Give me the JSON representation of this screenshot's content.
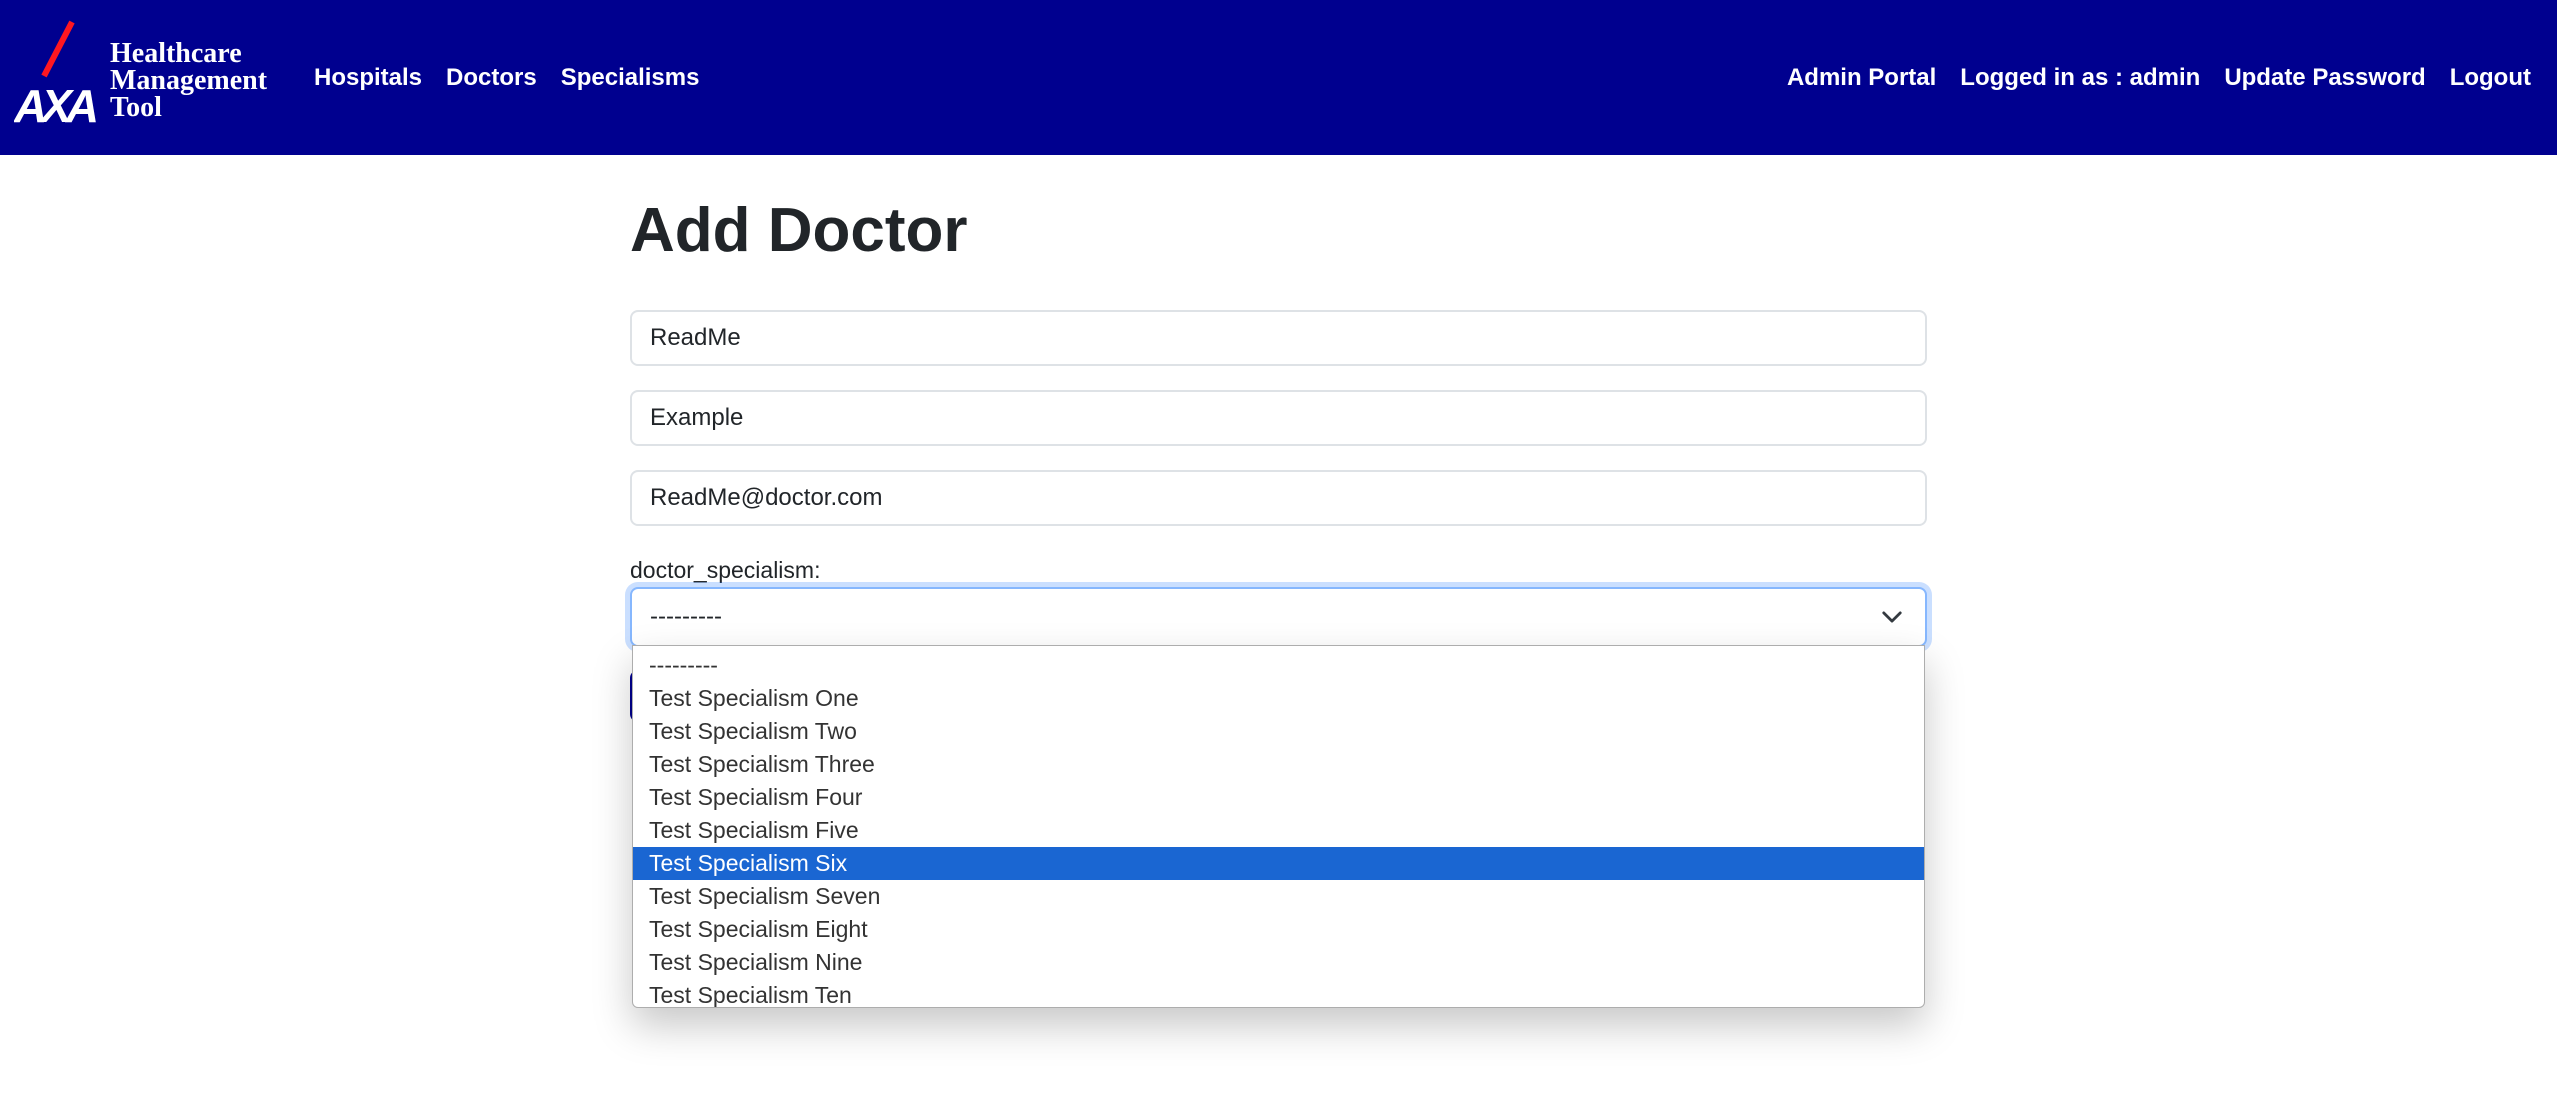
{
  "brand": {
    "logo_text": "AXA",
    "title_line1": "Healthcare",
    "title_line2": "Management",
    "title_line3": "Tool"
  },
  "nav": {
    "left": [
      "Hospitals",
      "Doctors",
      "Specialisms"
    ],
    "right": [
      "Admin Portal",
      "Logged in as : admin",
      "Update Password",
      "Logout"
    ]
  },
  "page": {
    "title": "Add Doctor"
  },
  "form": {
    "first_name_value": "ReadMe",
    "last_name_value": "Example",
    "email_value": "ReadMe@doctor.com",
    "specialism_label": "doctor_specialism:",
    "specialism_selected": "---------",
    "options": [
      "---------",
      "Test Specialism One",
      "Test Specialism Two",
      "Test Specialism Three",
      "Test Specialism Four",
      "Test Specialism Five",
      "Test Specialism Six",
      "Test Specialism Seven",
      "Test Specialism Eight",
      "Test Specialism Nine",
      "Test Specialism Ten"
    ],
    "highlighted_option": "Test Specialism Six"
  },
  "colors": {
    "navbar": "#00008f",
    "highlight": "#1a66d2",
    "logo_slash": "#ff1721"
  }
}
